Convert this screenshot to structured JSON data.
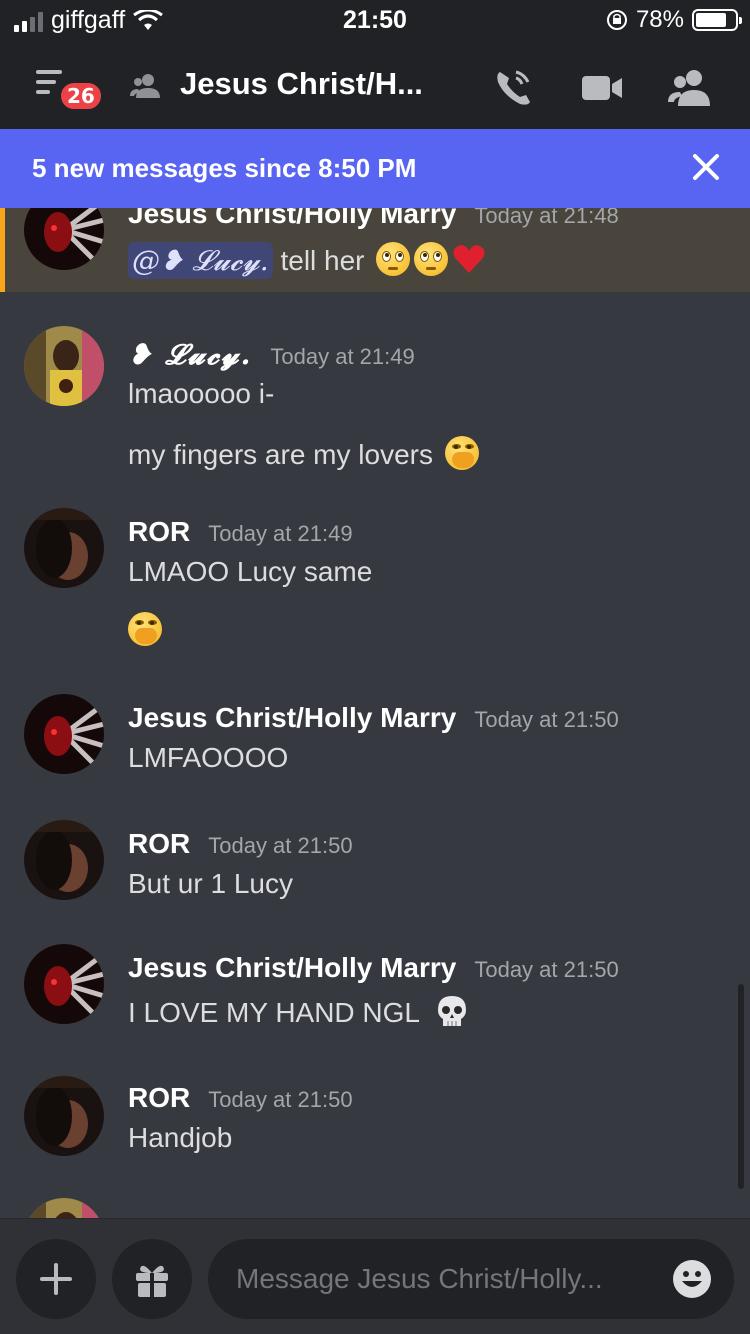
{
  "status_bar": {
    "carrier": "giffgaff",
    "time": "21:50",
    "battery": "78%"
  },
  "header": {
    "unread_badge": "26",
    "title": "Jesus Christ/H..."
  },
  "banner": {
    "text": "5 new messages since 8:50 PM"
  },
  "messages": [
    {
      "author": "Jesus Christ/Holly Marry",
      "time": "Today at 21:48",
      "mention": "@❥ 𝓛𝓾𝓬𝔂.",
      "text": " tell her",
      "emojis": [
        "face-with-rolling-eyes",
        "face-with-rolling-eyes",
        "red-heart"
      ]
    },
    {
      "author": "❥ 𝓛𝓾𝓬𝔂.",
      "time": "Today at 21:49",
      "lines": [
        "lmaooooo i-",
        "my fingers are my lovers"
      ]
    },
    {
      "author": "ROR",
      "time": "Today at 21:49",
      "lines": [
        "LMAOO Lucy same"
      ]
    },
    {
      "author": "Jesus Christ/Holly Marry",
      "time": "Today at 21:50",
      "lines": [
        "LMFAOOOO"
      ]
    },
    {
      "author": "ROR",
      "time": "Today at 21:50",
      "lines": [
        "But ur 1 Lucy"
      ]
    },
    {
      "author": "Jesus Christ/Holly Marry",
      "time": "Today at 21:50",
      "lines": [
        "I LOVE MY HAND NGL"
      ]
    },
    {
      "author": "ROR",
      "time": "Today at 21:50",
      "lines": [
        "Handjob"
      ]
    }
  ],
  "composer": {
    "placeholder": "Message Jesus Christ/Holly..."
  },
  "icons": [
    "hamburger-icon",
    "dm-people-icon",
    "call-icon",
    "video-icon",
    "members-icon",
    "close-icon",
    "plus-icon",
    "gift-icon",
    "emoji-icon"
  ],
  "colors": {
    "banner": "#5865f2",
    "badge": "#ed4245",
    "mention_bg": "#404675",
    "highlight_bar": "#faa61a"
  }
}
